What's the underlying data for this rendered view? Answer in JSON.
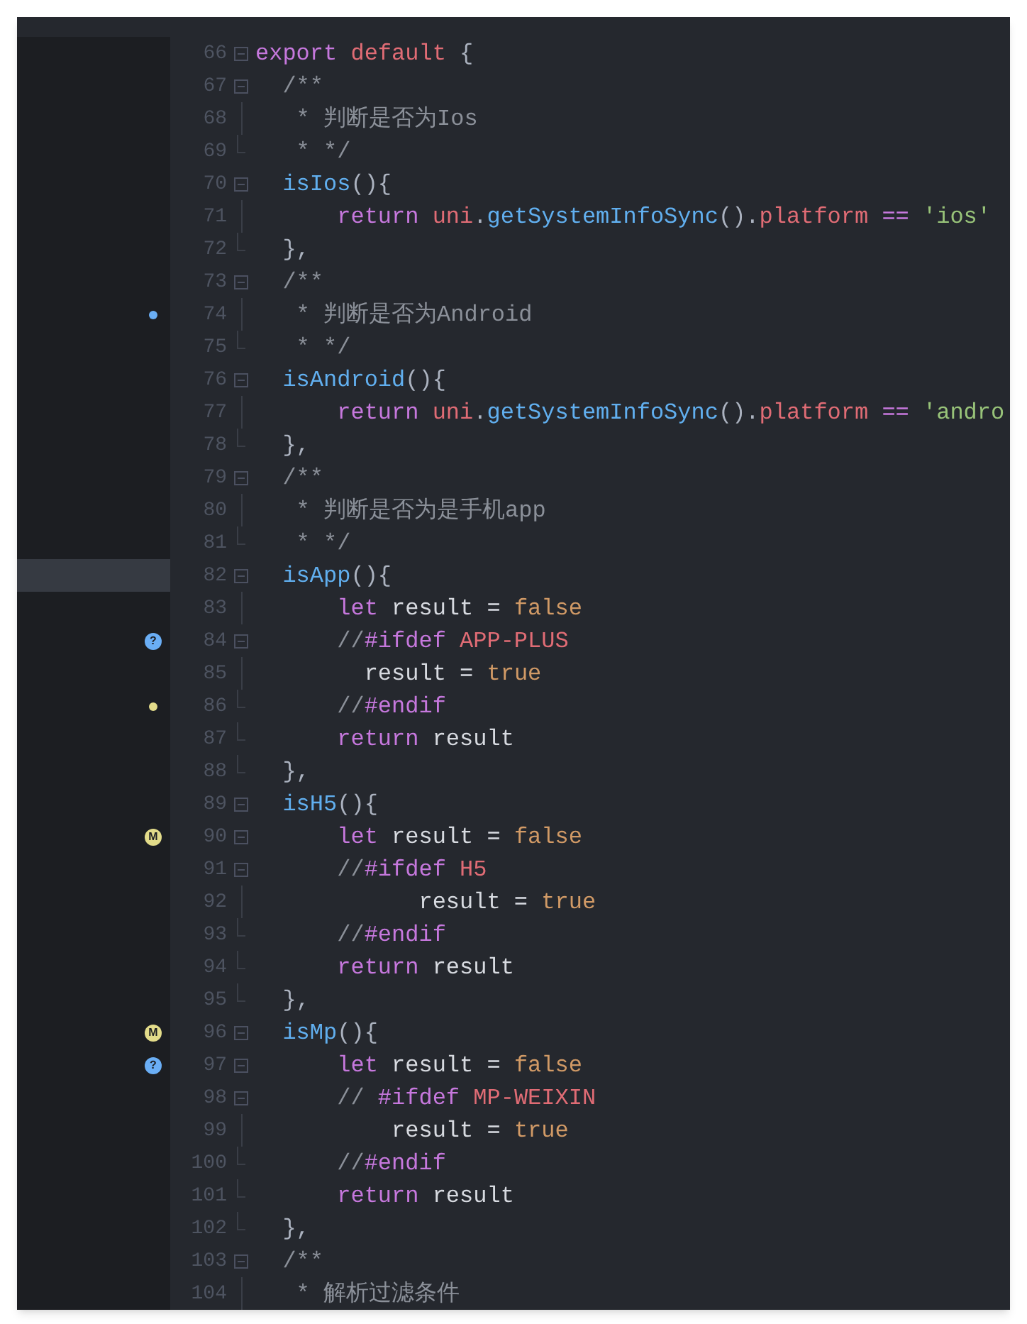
{
  "editor": {
    "lines": [
      {
        "number": "66",
        "kind": "start",
        "current": false,
        "tokens": [
          {
            "text": "export ",
            "kind": "keyword"
          },
          {
            "text": "default",
            "kind": "builtin"
          },
          {
            "text": " {",
            "kind": "punct"
          }
        ]
      },
      {
        "number": "67",
        "kind": "start",
        "current": false,
        "tokens": [
          {
            "text": "  /**",
            "kind": "comment"
          }
        ]
      },
      {
        "number": "68",
        "kind": "guide",
        "current": false,
        "tokens": [
          {
            "text": "   * 判断是否为Ios",
            "kind": "comment"
          }
        ]
      },
      {
        "number": "69",
        "kind": "end",
        "current": false,
        "tokens": [
          {
            "text": "   * */",
            "kind": "comment"
          }
        ]
      },
      {
        "number": "70",
        "kind": "start",
        "current": false,
        "tokens": [
          {
            "text": "  isIos",
            "kind": "function"
          },
          {
            "text": "(){",
            "kind": "punct"
          }
        ]
      },
      {
        "number": "71",
        "kind": "guide",
        "current": false,
        "tokens": [
          {
            "text": "      return",
            "kind": "keyword"
          },
          {
            "text": " uni",
            "kind": "builtin"
          },
          {
            "text": ".",
            "kind": "punct"
          },
          {
            "text": "getSystemInfoSync",
            "kind": "function"
          },
          {
            "text": "().",
            "kind": "punct"
          },
          {
            "text": "platform",
            "kind": "builtin"
          },
          {
            "text": " == ",
            "kind": "keyword"
          },
          {
            "text": "'ios'",
            "kind": "string"
          }
        ]
      },
      {
        "number": "72",
        "kind": "end",
        "current": false,
        "tokens": [
          {
            "text": "  },",
            "kind": "punct"
          }
        ]
      },
      {
        "number": "73",
        "kind": "start",
        "current": false,
        "tokens": [
          {
            "text": "  /**",
            "kind": "comment"
          }
        ]
      },
      {
        "number": "74",
        "kind": "guide",
        "current": false,
        "marker": {
          "kind": "dot",
          "color": "#6aaef5"
        },
        "tokens": [
          {
            "text": "   * 判断是否为Android",
            "kind": "comment"
          }
        ]
      },
      {
        "number": "75",
        "kind": "end",
        "current": false,
        "tokens": [
          {
            "text": "   * */",
            "kind": "comment"
          }
        ]
      },
      {
        "number": "76",
        "kind": "start",
        "current": false,
        "tokens": [
          {
            "text": "  isAndroid",
            "kind": "function"
          },
          {
            "text": "(){",
            "kind": "punct"
          }
        ]
      },
      {
        "number": "77",
        "kind": "guide",
        "current": false,
        "tokens": [
          {
            "text": "      return",
            "kind": "keyword"
          },
          {
            "text": " uni",
            "kind": "builtin"
          },
          {
            "text": ".",
            "kind": "punct"
          },
          {
            "text": "getSystemInfoSync",
            "kind": "function"
          },
          {
            "text": "().",
            "kind": "punct"
          },
          {
            "text": "platform",
            "kind": "builtin"
          },
          {
            "text": " == ",
            "kind": "keyword"
          },
          {
            "text": "'andro",
            "kind": "string"
          }
        ]
      },
      {
        "number": "78",
        "kind": "end",
        "current": false,
        "tokens": [
          {
            "text": "  },",
            "kind": "punct"
          }
        ]
      },
      {
        "number": "79",
        "kind": "start",
        "current": false,
        "tokens": [
          {
            "text": "  /**",
            "kind": "comment"
          }
        ]
      },
      {
        "number": "80",
        "kind": "guide",
        "current": false,
        "tokens": [
          {
            "text": "   * 判断是否为是手机app",
            "kind": "comment"
          }
        ]
      },
      {
        "number": "81",
        "kind": "end",
        "current": false,
        "tokens": [
          {
            "text": "   * */",
            "kind": "comment"
          }
        ]
      },
      {
        "number": "82",
        "kind": "start",
        "current": true,
        "tokens": [
          {
            "text": "  isApp",
            "kind": "function"
          },
          {
            "text": "(){",
            "kind": "punct"
          }
        ]
      },
      {
        "number": "83",
        "kind": "guide",
        "current": false,
        "tokens": [
          {
            "text": "      let",
            "kind": "keyword"
          },
          {
            "text": " result = ",
            "kind": "variable"
          },
          {
            "text": "false",
            "kind": "literal"
          }
        ]
      },
      {
        "number": "84",
        "kind": "start",
        "current": false,
        "marker": {
          "kind": "badge",
          "label": "?",
          "color": "#6aaef5"
        },
        "tokens": [
          {
            "text": "      //",
            "kind": "comment"
          },
          {
            "text": "#ifdef",
            "kind": "keyword"
          },
          {
            "text": " APP-PLUS",
            "kind": "builtin"
          }
        ]
      },
      {
        "number": "85",
        "kind": "guide",
        "current": false,
        "tokens": [
          {
            "text": "        result = ",
            "kind": "variable"
          },
          {
            "text": "true",
            "kind": "literal"
          }
        ]
      },
      {
        "number": "86",
        "kind": "end",
        "current": false,
        "marker": {
          "kind": "dot",
          "color": "#e3dc8a"
        },
        "tokens": [
          {
            "text": "      //",
            "kind": "comment"
          },
          {
            "text": "#endif",
            "kind": "keyword"
          }
        ]
      },
      {
        "number": "87",
        "kind": "end",
        "current": false,
        "tokens": [
          {
            "text": "      return",
            "kind": "keyword"
          },
          {
            "text": " result",
            "kind": "variable"
          }
        ]
      },
      {
        "number": "88",
        "kind": "end",
        "current": false,
        "tokens": [
          {
            "text": "  },",
            "kind": "punct"
          }
        ]
      },
      {
        "number": "89",
        "kind": "start",
        "current": false,
        "tokens": [
          {
            "text": "  isH5",
            "kind": "function"
          },
          {
            "text": "(){",
            "kind": "punct"
          }
        ]
      },
      {
        "number": "90",
        "kind": "start",
        "current": false,
        "marker": {
          "kind": "badge",
          "label": "M",
          "color": "#e3dc8a"
        },
        "tokens": [
          {
            "text": "      let",
            "kind": "keyword"
          },
          {
            "text": " result = ",
            "kind": "variable"
          },
          {
            "text": "false",
            "kind": "literal"
          }
        ]
      },
      {
        "number": "91",
        "kind": "start",
        "current": false,
        "tokens": [
          {
            "text": "      //",
            "kind": "comment"
          },
          {
            "text": "#ifdef",
            "kind": "keyword"
          },
          {
            "text": " H5",
            "kind": "builtin"
          }
        ]
      },
      {
        "number": "92",
        "kind": "guide",
        "current": false,
        "tokens": [
          {
            "text": "            result = ",
            "kind": "variable"
          },
          {
            "text": "true",
            "kind": "literal"
          }
        ]
      },
      {
        "number": "93",
        "kind": "end",
        "current": false,
        "tokens": [
          {
            "text": "      //",
            "kind": "comment"
          },
          {
            "text": "#endif",
            "kind": "keyword"
          }
        ]
      },
      {
        "number": "94",
        "kind": "end",
        "current": false,
        "tokens": [
          {
            "text": "      return",
            "kind": "keyword"
          },
          {
            "text": " result",
            "kind": "variable"
          }
        ]
      },
      {
        "number": "95",
        "kind": "end",
        "current": false,
        "tokens": [
          {
            "text": "  },",
            "kind": "punct"
          }
        ]
      },
      {
        "number": "96",
        "kind": "start",
        "current": false,
        "marker": {
          "kind": "badge",
          "label": "M",
          "color": "#e3dc8a"
        },
        "tokens": [
          {
            "text": "  isMp",
            "kind": "function"
          },
          {
            "text": "(){",
            "kind": "punct"
          }
        ]
      },
      {
        "number": "97",
        "kind": "start",
        "current": false,
        "marker": {
          "kind": "badge",
          "label": "?",
          "color": "#6aaef5"
        },
        "tokens": [
          {
            "text": "      let",
            "kind": "keyword"
          },
          {
            "text": " result = ",
            "kind": "variable"
          },
          {
            "text": "false",
            "kind": "literal"
          }
        ]
      },
      {
        "number": "98",
        "kind": "start",
        "current": false,
        "tokens": [
          {
            "text": "      // ",
            "kind": "comment"
          },
          {
            "text": "#ifdef",
            "kind": "keyword"
          },
          {
            "text": " MP-WEIXIN",
            "kind": "builtin"
          }
        ]
      },
      {
        "number": "99",
        "kind": "guide",
        "current": false,
        "tokens": [
          {
            "text": "          result = ",
            "kind": "variable"
          },
          {
            "text": "true",
            "kind": "literal"
          }
        ]
      },
      {
        "number": "100",
        "kind": "end",
        "current": false,
        "tokens": [
          {
            "text": "      //",
            "kind": "comment"
          },
          {
            "text": "#endif",
            "kind": "keyword"
          }
        ]
      },
      {
        "number": "101",
        "kind": "end",
        "current": false,
        "tokens": [
          {
            "text": "      return",
            "kind": "keyword"
          },
          {
            "text": " result",
            "kind": "variable"
          }
        ]
      },
      {
        "number": "102",
        "kind": "end",
        "current": false,
        "tokens": [
          {
            "text": "  },",
            "kind": "punct"
          }
        ]
      },
      {
        "number": "103",
        "kind": "start",
        "current": false,
        "tokens": [
          {
            "text": "  /**",
            "kind": "comment"
          }
        ]
      },
      {
        "number": "104",
        "kind": "guide",
        "current": false,
        "tokens": [
          {
            "text": "   * 解析过滤条件",
            "kind": "comment"
          }
        ]
      }
    ]
  }
}
